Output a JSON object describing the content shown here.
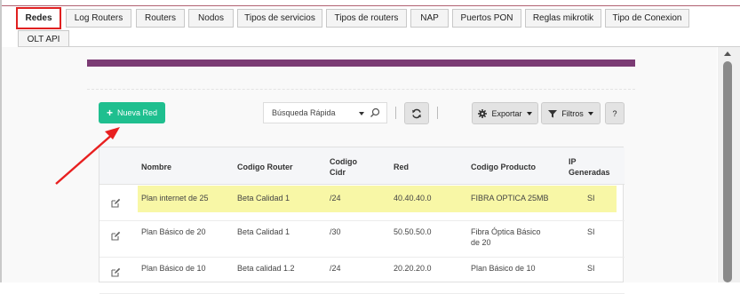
{
  "tabs": [
    {
      "label": "Redes",
      "active": true
    },
    {
      "label": "Log Routers"
    },
    {
      "label": "Routers"
    },
    {
      "label": "Nodos"
    },
    {
      "label": "Tipos de servicios"
    },
    {
      "label": "Tipos de routers"
    },
    {
      "label": "NAP"
    },
    {
      "label": "Puertos PON"
    },
    {
      "label": "Reglas mikrotik"
    },
    {
      "label": "Tipo de Conexion"
    },
    {
      "label": "OLT API"
    }
  ],
  "toolbar": {
    "new_label": "Nueva Red",
    "search_value": "Búsqueda Rápida",
    "export_label": "Exportar",
    "filters_label": "Filtros",
    "help_label": "?"
  },
  "table": {
    "headers": {
      "nombre": "Nombre",
      "router": "Codigo Router",
      "cidr_1": "Codigo",
      "cidr_2": "Cidr",
      "red": "Red",
      "producto": "Codigo Producto",
      "ip_1": "IP",
      "ip_2": "Generadas"
    },
    "rows": [
      {
        "nombre": "Plan internet de 25",
        "router": "Beta Calidad 1",
        "cidr": "/24",
        "red": "40.40.40.0",
        "producto_1": "FIBRA OPTICA 25MB",
        "producto_2": "",
        "ip": "SI",
        "highlighted": true
      },
      {
        "nombre": "Plan Básico de 20",
        "router": "Beta Calidad 1",
        "cidr": "/30",
        "red": "50.50.50.0",
        "producto_1": "Fibra Óptica Básico",
        "producto_2": "de 20",
        "ip": "SI"
      },
      {
        "nombre": "Plan Básico de 10",
        "router": "Beta calidad 1.2",
        "cidr": "/24",
        "red": "20.20.20.0",
        "producto_1": "Plan Básico de 10",
        "producto_2": "",
        "ip": "SI"
      }
    ]
  },
  "colors": {
    "accent_purple": "#7b3b74",
    "new_button": "#1fbf8f",
    "highlight": "#f8f7a6",
    "annotation_red": "#e02020"
  },
  "icons": [
    "plus-icon",
    "search-icon",
    "refresh-icon",
    "gear-icon",
    "filter-icon",
    "edit-icon",
    "annotation-arrow-icon"
  ]
}
